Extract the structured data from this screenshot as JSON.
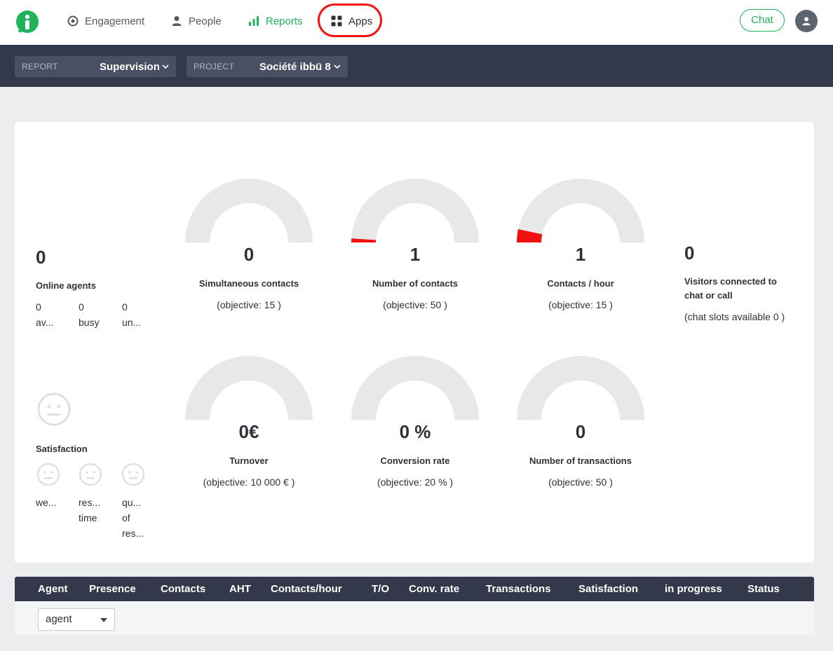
{
  "nav": {
    "engagement": "Engagement",
    "people": "People",
    "reports": "Reports",
    "apps": "Apps",
    "chat": "Chat"
  },
  "filters": {
    "report_label": "REPORT",
    "report_value": "Supervision",
    "project_label": "PROJECT",
    "project_value": "Société ibbü 8"
  },
  "agents": {
    "count": "0",
    "title": "Online agents",
    "available_count": "0",
    "available_label": "av...",
    "busy_count": "0",
    "busy_label": "busy",
    "unavailable_count": "0",
    "unavailable_label": "un..."
  },
  "satisfaction": {
    "title": "Satisfaction",
    "sub1": "we...",
    "sub2_line1": "res...",
    "sub2_line2": "time",
    "sub3_line1": "qu...",
    "sub3_line2": "of",
    "sub3_line3": "res..."
  },
  "metrics": [
    {
      "value": "0",
      "title": "Simultaneous contacts",
      "objective": "(objective: 15 )",
      "fill": 0
    },
    {
      "value": "1",
      "title": "Number of contacts",
      "objective": "(objective: 50 )",
      "fill": 0.02
    },
    {
      "value": "1",
      "title": "Contacts / hour",
      "objective": "(objective: 15 )",
      "fill": 0.0667
    },
    {
      "value": "0€",
      "title": "Turnover",
      "objective": "(objective: 10 000 € )",
      "fill": 0
    },
    {
      "value": "0 %",
      "title": "Conversion rate",
      "objective": "(objective: 20 % )",
      "fill": 0
    },
    {
      "value": "0",
      "title": "Number of transactions",
      "objective": "(objective: 50 )",
      "fill": 0
    }
  ],
  "visitors": {
    "count": "0",
    "title_line1": "Visitors connected to",
    "title_line2": "chat or call",
    "slots": "(chat slots available 0 )"
  },
  "table": {
    "columns": [
      "Agent",
      "Presence",
      "Contacts",
      "AHT",
      "Contacts/hour",
      "T/O",
      "Conv. rate",
      "Transactions",
      "Satisfaction",
      "in progress",
      "Status"
    ],
    "agent_filter": "agent"
  },
  "colors": {
    "accent_green": "#1fb25a",
    "gauge_fill": "#f01010",
    "gauge_track": "#e8e8e8",
    "header_dark": "#33394a"
  }
}
